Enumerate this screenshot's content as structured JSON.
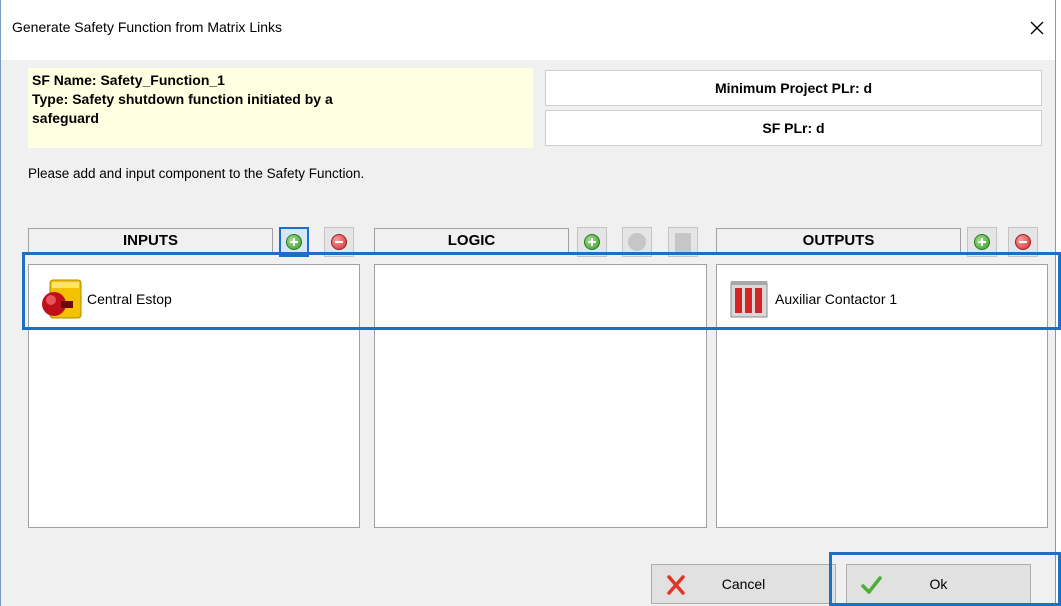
{
  "window": {
    "title": "Generate Safety Function from Matrix Links"
  },
  "sf_info": {
    "name": "SF Name: Safety_Function_1",
    "type_line1": "Type: Safety shutdown function initiated by a",
    "type_line2": "safeguard"
  },
  "plr": {
    "minimum_project": "Minimum Project PLr: d",
    "sf": "SF PLr: d"
  },
  "instruction": "Please add and input component to the Safety Function.",
  "columns": {
    "inputs": {
      "header": "INPUTS",
      "items": [
        "Central Estop"
      ]
    },
    "logic": {
      "header": "LOGIC",
      "items": []
    },
    "outputs": {
      "header": "OUTPUTS",
      "items": [
        "Auxiliar Contactor 1"
      ]
    }
  },
  "buttons": {
    "cancel": "Cancel",
    "ok": "Ok"
  },
  "icons": {
    "add": "add-green-circle-icon",
    "remove": "remove-red-circle-icon",
    "close": "close-x-icon",
    "cancel": "red-x-icon",
    "ok": "green-check-icon"
  },
  "colors": {
    "highlight": "#1e6fc3",
    "info_background": "#ffffe1"
  }
}
